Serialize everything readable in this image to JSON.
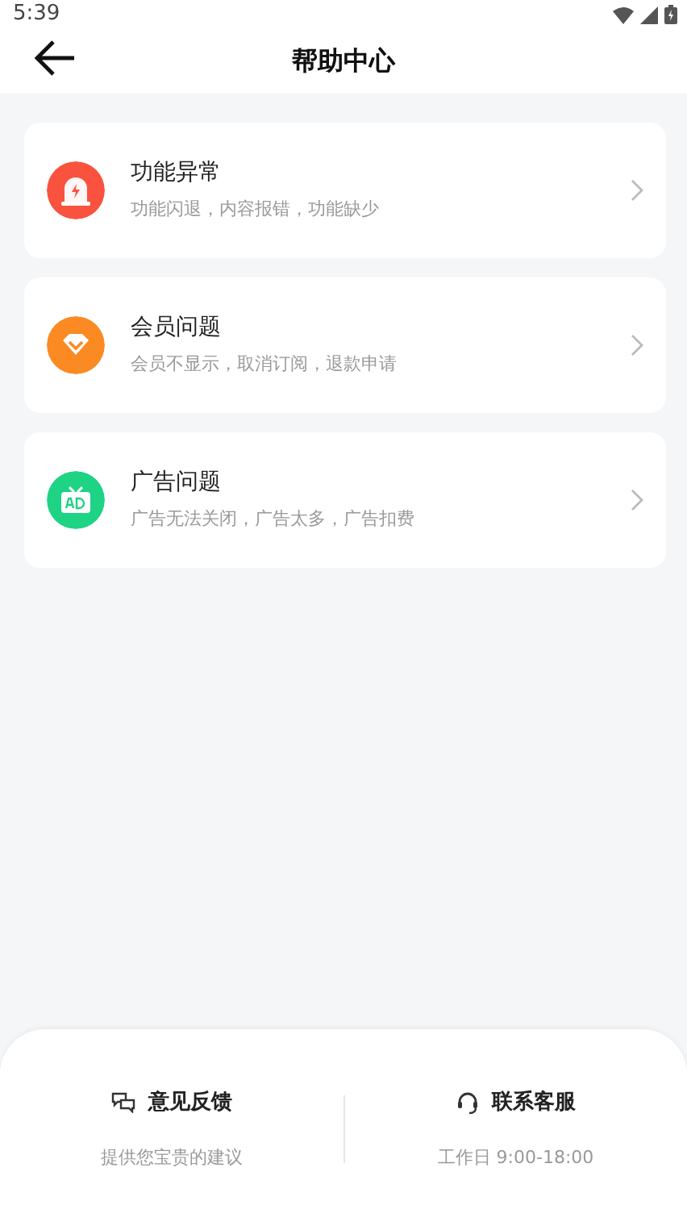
{
  "status_bar": {
    "time": "5:39"
  },
  "header": {
    "title": "帮助中心"
  },
  "categories": [
    {
      "kind": "bug",
      "color": "#f9533f",
      "title": "功能异常",
      "subtitle": "功能闪退，内容报错，功能缺少"
    },
    {
      "kind": "vip",
      "color": "#fb8a22",
      "title": "会员问题",
      "subtitle": "会员不显示，取消订阅，退款申请"
    },
    {
      "kind": "ad",
      "color": "#1ed384",
      "title": "广告问题",
      "subtitle": "广告无法关闭，广告太多，广告扣费"
    }
  ],
  "footer": [
    {
      "kind": "feedback",
      "title": "意见反馈",
      "subtitle": "提供您宝贵的建议"
    },
    {
      "kind": "service",
      "title": "联系客服",
      "subtitle": "工作日 9:00-18:00"
    }
  ]
}
